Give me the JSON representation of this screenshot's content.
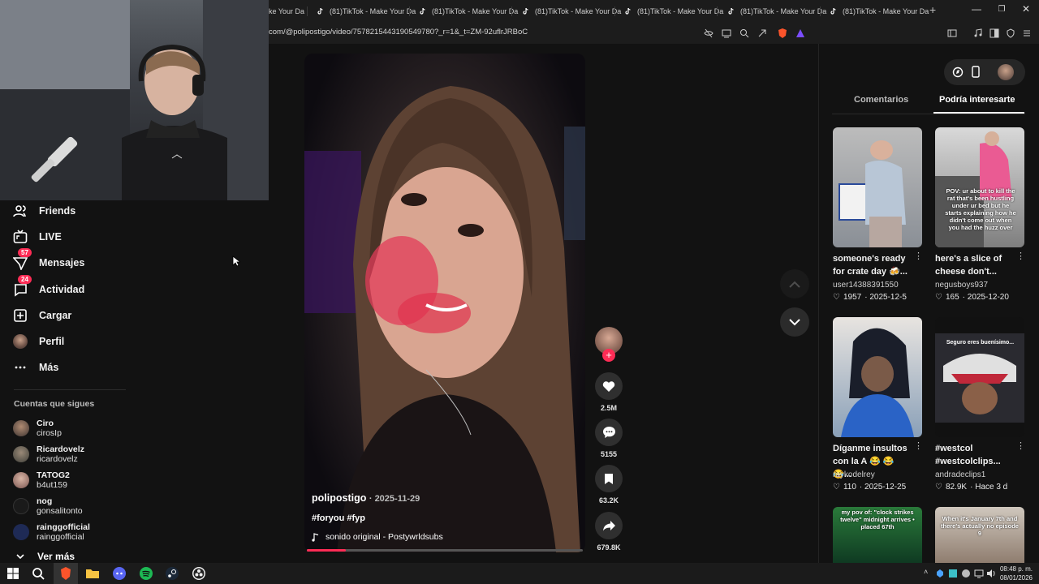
{
  "browser": {
    "tabs": [
      {
        "title": "ke Your Da"
      },
      {
        "title": "(81)TikTok - Make Your Da"
      },
      {
        "title": "(81)TikTok - Make Your Da"
      },
      {
        "title": "(81)TikTok - Make Your Da"
      },
      {
        "title": "(81)TikTok - Make Your Da"
      },
      {
        "title": "(81)TikTok - Make Your Da"
      },
      {
        "title": "(81)TikTok - Make Your Da"
      }
    ],
    "new_tab": "+",
    "window_controls": {
      "minimize": "—",
      "restore": "❐",
      "close": "✕"
    },
    "url": "com/@polipostigo/video/7578215443190549780?_r=1&_t=ZM-92uflrJRBoC",
    "icons": [
      "eye-off-icon",
      "cast-icon",
      "zoom-icon",
      "share-icon",
      "brave-shield-icon",
      "rewards-icon",
      "sidebar-icon",
      "music-icon",
      "split-icon",
      "vpn-icon",
      "menu-icon"
    ],
    "brand_colors": {
      "brave": "#fb542b",
      "rewards": "#7b4dff"
    }
  },
  "sidebar": {
    "nav": [
      {
        "label": "Friends",
        "icon": "friends-icon"
      },
      {
        "label": "LIVE",
        "icon": "live-icon"
      },
      {
        "label": "Mensajes",
        "icon": "messages-icon",
        "badge": "57"
      },
      {
        "label": "Actividad",
        "icon": "activity-icon",
        "badge": "24"
      },
      {
        "label": "Cargar",
        "icon": "upload-icon"
      },
      {
        "label": "Perfil",
        "icon": "avatar"
      },
      {
        "label": "Más",
        "icon": "more-icon"
      }
    ],
    "following_title": "Cuentas que sigues",
    "following": [
      {
        "name": "Ciro",
        "handle": "cirosIp"
      },
      {
        "name": "Ricardovelz",
        "handle": "ricardovelz"
      },
      {
        "name": "TATOG2",
        "handle": "b4ut159"
      },
      {
        "name": "nog",
        "handle": "gonsalitonto"
      },
      {
        "name": "rainggofficial",
        "handle": "rainggofficial"
      }
    ],
    "see_more": "Ver más"
  },
  "video": {
    "author": "polipostigo",
    "date": "· 2025-11-29",
    "hashtags": "#foryou #fyp",
    "sound": "sonido original - Postywrldsubs",
    "progress": 0.14,
    "likes": "2.5M",
    "comments": "5155",
    "saves": "63.2K",
    "shares": "679.8K"
  },
  "right_panel": {
    "tabs": [
      {
        "label": "Comentarios",
        "active": false
      },
      {
        "label": "Podría interesarte",
        "active": true
      }
    ],
    "cards": [
      {
        "title": "someone's ready for crate day 🍻...",
        "user": "user14388391550",
        "likes": "1957",
        "date": "· 2025-12-5",
        "overlay": ""
      },
      {
        "title": "here's a slice of cheese don't...",
        "user": "negusboys937",
        "likes": "165",
        "date": "· 2025-12-20",
        "overlay": "POV: ur about to kill the rat that's been hustling under ur bed but he starts explaining how he didn't come out when you had the huzz over"
      },
      {
        "title": "Díganme insultos con la A 😂 😂 😂...",
        "user": "raykodelrey",
        "likes": "110",
        "date": "· 2025-12-25",
        "overlay": ""
      },
      {
        "title": "#westcol #westcolclips...",
        "user": "andradeclips1",
        "likes": "82.9K",
        "date": "· Hace 3 d",
        "overlay": "Seguro eres buenísimo..."
      },
      {
        "title": "",
        "user": "",
        "likes": "",
        "date": "",
        "overlay": "my pov of: \"clock strikes twelve\" midnight arrives • placed 67th"
      },
      {
        "title": "",
        "user": "",
        "likes": "",
        "date": "",
        "overlay": "When it's January 7th and there's actually no episode 9"
      }
    ]
  },
  "taskbar": {
    "time": "08:48 p. m.",
    "date": "08/01/2026"
  },
  "colors": {
    "accent": "#fe2c55",
    "bg": "#121212"
  }
}
